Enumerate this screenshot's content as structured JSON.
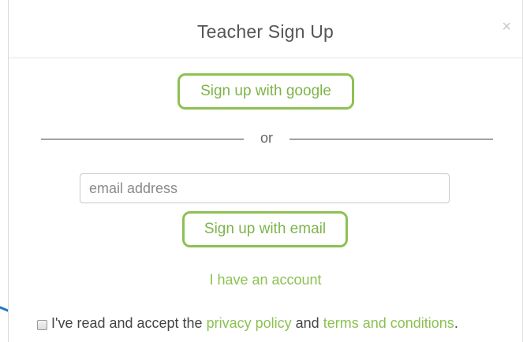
{
  "modal": {
    "title": "Teacher Sign Up",
    "close_glyph": "×"
  },
  "signup": {
    "google_button_label": "Sign up with google",
    "divider_text": "or",
    "email_placeholder": "email address",
    "email_value": "",
    "email_button_label": "Sign up with email",
    "account_link_label": "I have an account"
  },
  "terms": {
    "prefix": "I've read and accept the",
    "privacy_link": "privacy policy",
    "conjunction": "and",
    "terms_link": "terms and conditions",
    "suffix": ".",
    "checked": false
  },
  "colors": {
    "accent_green": "#8cc152",
    "annotation_arrow": "#1f77c8"
  },
  "icons": {
    "close": "close-icon",
    "annotation": "arrow-icon"
  }
}
